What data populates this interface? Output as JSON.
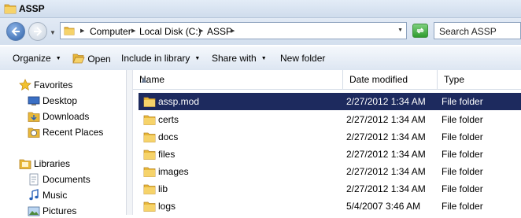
{
  "window": {
    "title": "ASSP"
  },
  "address": {
    "crumbs": [
      "Computer",
      "Local Disk (C:)",
      "ASSP"
    ]
  },
  "search": {
    "placeholder": "Search ASSP"
  },
  "toolbar": {
    "organize": "Organize",
    "open": "Open",
    "include": "Include in library",
    "share": "Share with",
    "new_folder": "New folder"
  },
  "nav": {
    "favorites": "Favorites",
    "desktop": "Desktop",
    "downloads": "Downloads",
    "recent": "Recent Places",
    "libraries": "Libraries",
    "documents": "Documents",
    "music": "Music",
    "pictures": "Pictures"
  },
  "columns": {
    "name": "Name",
    "date": "Date modified",
    "type": "Type"
  },
  "files": [
    {
      "name": "assp.mod",
      "date": "2/27/2012 1:34 AM",
      "type": "File folder",
      "selected": true
    },
    {
      "name": "certs",
      "date": "2/27/2012 1:34 AM",
      "type": "File folder"
    },
    {
      "name": "docs",
      "date": "2/27/2012 1:34 AM",
      "type": "File folder"
    },
    {
      "name": "files",
      "date": "2/27/2012 1:34 AM",
      "type": "File folder"
    },
    {
      "name": "images",
      "date": "2/27/2012 1:34 AM",
      "type": "File folder"
    },
    {
      "name": "lib",
      "date": "2/27/2012 1:34 AM",
      "type": "File folder"
    },
    {
      "name": "logs",
      "date": "5/4/2007 3:46 AM",
      "type": "File folder"
    }
  ],
  "colors": {
    "selection": "#1d2a5e",
    "folder": "#e8b838"
  }
}
